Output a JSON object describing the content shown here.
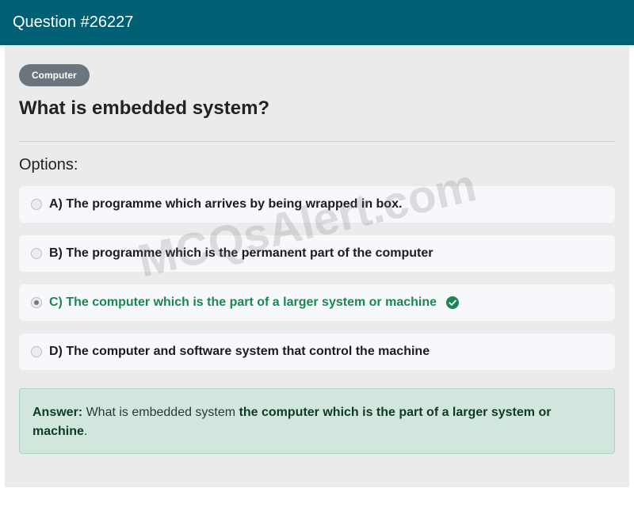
{
  "header": {
    "title": "Question #26227"
  },
  "question": {
    "category": "Computer",
    "text": "What is embedded system?",
    "options_label": "Options:",
    "options": [
      {
        "label": "A) The programme which arrives by being wrapped in box.",
        "selected": false,
        "correct": false
      },
      {
        "label": "B) The programme which is the permanent part of the computer",
        "selected": false,
        "correct": false
      },
      {
        "label": "C) The computer which is the part of a larger system or machine",
        "selected": true,
        "correct": true
      },
      {
        "label": "D) The computer and software system that control the machine",
        "selected": false,
        "correct": false
      }
    ]
  },
  "answer": {
    "prefix": "Answer:",
    "lead": "What is embedded system",
    "value": "the computer which is the part of a larger system or machine",
    "suffix": "."
  },
  "watermark": "MCQsAlert.com",
  "colors": {
    "header_bg": "#005f73",
    "correct": "#198754",
    "answer_bg": "#d1e7dd",
    "badge_bg": "#6c757d"
  },
  "icons": {
    "correct": "check-circle-icon"
  }
}
